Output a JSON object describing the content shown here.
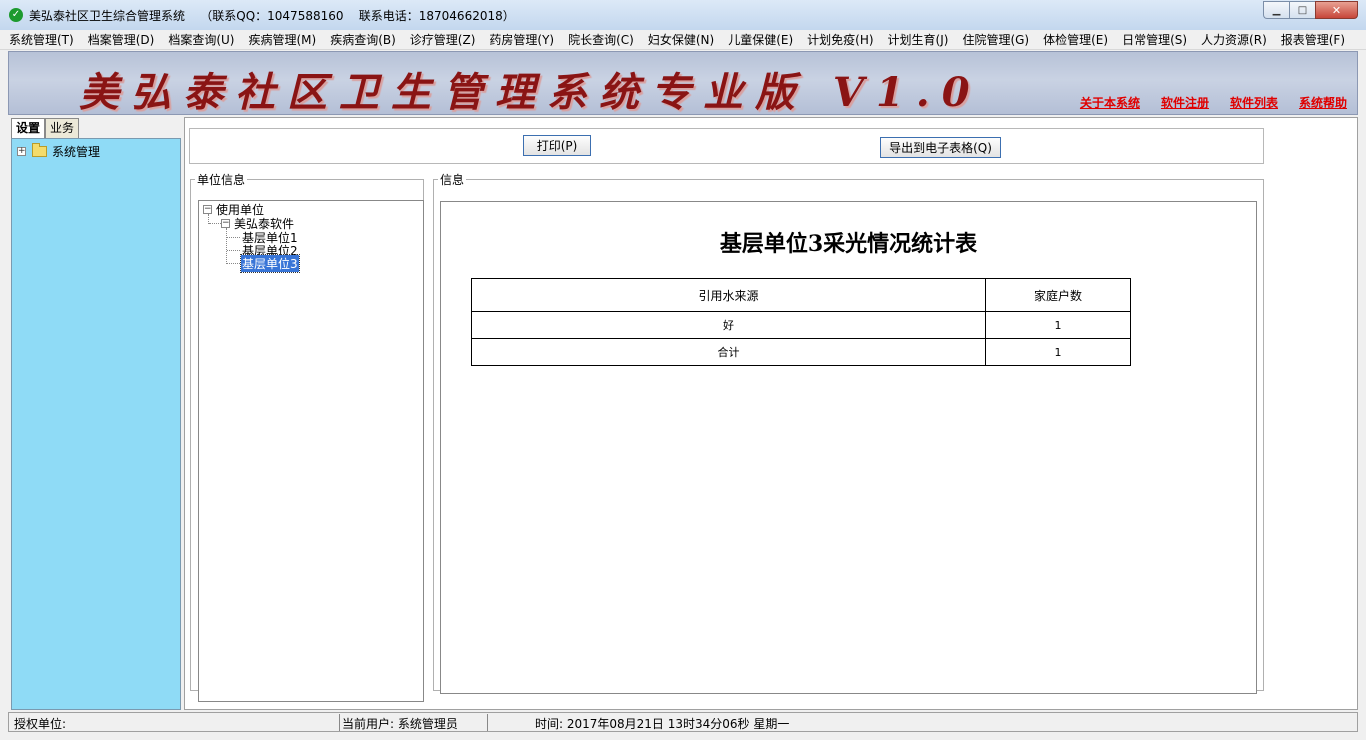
{
  "window": {
    "title": "美弘泰社区卫生综合管理系统    （联系QQ：1047588160    联系电话：18704662018）",
    "icon": "check-circle-icon",
    "min_label": "▁",
    "max_label": "□",
    "close_label": "✕"
  },
  "menu": [
    "系统管理(T)",
    "档案管理(D)",
    "档案查询(U)",
    "疾病管理(M)",
    "疾病查询(B)",
    "诊疗管理(Z)",
    "药房管理(Y)",
    "院长查询(C)",
    "妇女保健(N)",
    "儿童保健(E)",
    "计划免疫(H)",
    "计划生育(J)",
    "住院管理(G)",
    "体检管理(E)",
    "日常管理(S)",
    "人力资源(R)",
    "报表管理(F)"
  ],
  "banner": {
    "title": "美弘泰社区卫生管理系统专业版 V1.0",
    "links": [
      "关于本系统",
      "软件注册",
      "软件列表",
      "系统帮助"
    ],
    "link_color": "#e00000",
    "title_color": "#8a1414"
  },
  "left": {
    "tabs": [
      "设置",
      "业务"
    ],
    "tree_root": "系统管理",
    "bg_color": "#8fdbf6"
  },
  "toolbar": {
    "print_label": "打印(P)",
    "export_label": "导出到电子表格(Q)"
  },
  "unit_panel": {
    "legend": "单位信息",
    "root": "使用单位",
    "company": "美弘泰软件",
    "units": [
      "基层单位1",
      "基层单位2",
      "基层单位3"
    ],
    "selected_index": 2
  },
  "info_panel": {
    "legend": "信息",
    "report_title": "基层单位3采光情况统计表",
    "table": {
      "headers": [
        "引用水来源",
        "家庭户数"
      ],
      "rows": [
        [
          "好",
          "1"
        ],
        [
          "合计",
          "1"
        ]
      ]
    }
  },
  "status": {
    "auth_unit": "授权单位:",
    "current_user": "当前用户: 系统管理员",
    "time": "时间: 2017年08月21日  13时34分06秒  星期一"
  }
}
